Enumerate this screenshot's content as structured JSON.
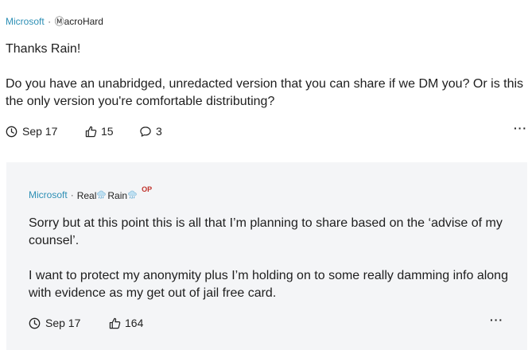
{
  "post": {
    "company": "Microsoft",
    "separator": "·",
    "username": "ⓂacroHard",
    "greeting": "Thanks Rain!",
    "body": "Do you have an unabridged, unredacted version that you can share if we DM you? Or is this the only version you're comfortable distributing?",
    "date": "Sep 17",
    "likes": "15",
    "comments": "3",
    "more": "···"
  },
  "reply": {
    "company": "Microsoft",
    "separator": "·",
    "username_part1": "Real",
    "username_part2": "Rain",
    "badge": "OP",
    "para1": "Sorry but at this point this is all that I’m planning to share based on the ‘advise of my counsel’.",
    "para2": "I want to protect my anonymity plus I’m holding on to some really damming info along with evidence as my get out of jail free card.",
    "date": "Sep 17",
    "likes": "164",
    "more": "···"
  },
  "icons": {
    "clock": "clock-icon",
    "like": "thumbs-up-icon",
    "comment": "comment-icon",
    "more": "more-options-icon",
    "weather": "rain-cloud-icon"
  }
}
